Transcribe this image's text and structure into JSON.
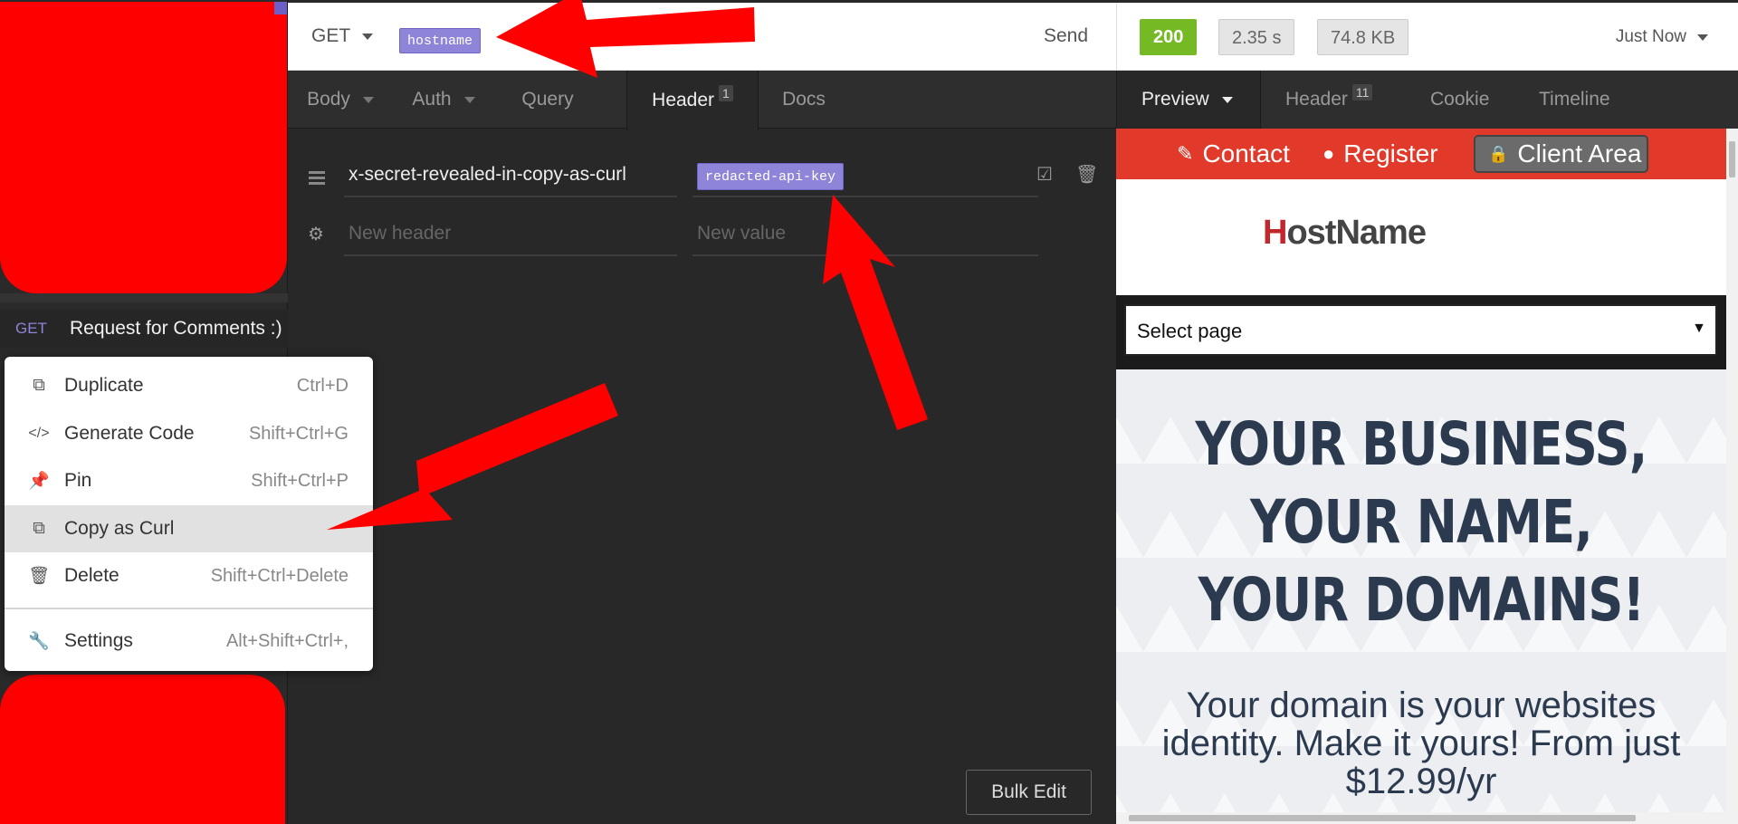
{
  "sidebar": {
    "request": {
      "method": "GET",
      "name": "Request for Comments :)"
    }
  },
  "context_menu": {
    "items": [
      {
        "label": "Duplicate",
        "shortcut": "Ctrl+D",
        "icon": "duplicate-icon"
      },
      {
        "label": "Generate Code",
        "shortcut": "Shift+Ctrl+G",
        "icon": "code-icon"
      },
      {
        "label": "Pin",
        "shortcut": "Shift+Ctrl+P",
        "icon": "pin-icon"
      },
      {
        "label": "Copy as Curl",
        "shortcut": "",
        "icon": "copy-icon",
        "highlighted": true
      },
      {
        "label": "Delete",
        "shortcut": "Shift+Ctrl+Delete",
        "icon": "trash-icon"
      },
      {
        "label": "Settings",
        "shortcut": "Alt+Shift+Ctrl+,",
        "icon": "wrench-icon"
      }
    ]
  },
  "request_bar": {
    "method": "GET",
    "url_tag": "hostname",
    "send_label": "Send"
  },
  "response_bar": {
    "status": "200",
    "time": "2.35 s",
    "size": "74.8 KB",
    "history": "Just Now"
  },
  "request_tabs": {
    "body": "Body",
    "auth": "Auth",
    "query": "Query",
    "header": "Header",
    "header_count": "1",
    "docs": "Docs"
  },
  "headers": {
    "rows": [
      {
        "name": "x-secret-revealed-in-copy-as-curl",
        "value_tag": "redacted-api-key"
      }
    ],
    "new_name_placeholder": "New header",
    "new_value_placeholder": "New value",
    "bulk_edit_label": "Bulk Edit"
  },
  "response_tabs": {
    "preview": "Preview",
    "header": "Header",
    "header_count": "11",
    "cookie": "Cookie",
    "timeline": "Timeline"
  },
  "preview_site": {
    "nav": {
      "contact": "Contact",
      "register": "Register",
      "client_area": "Client Area"
    },
    "logo_h": "H",
    "logo_rest": "ostName",
    "select_page": "Select page",
    "hero_title": "YOUR BUSINESS, YOUR NAME, YOUR DOMAINS!",
    "hero_sub": "Your domain is your websites identity. Make it yours! From just $12.99/yr"
  },
  "colors": {
    "env_tag": "#8e84d8",
    "status_ok": "#75ba24",
    "site_red": "#e13a2b",
    "annotation_red": "#ff0000"
  }
}
